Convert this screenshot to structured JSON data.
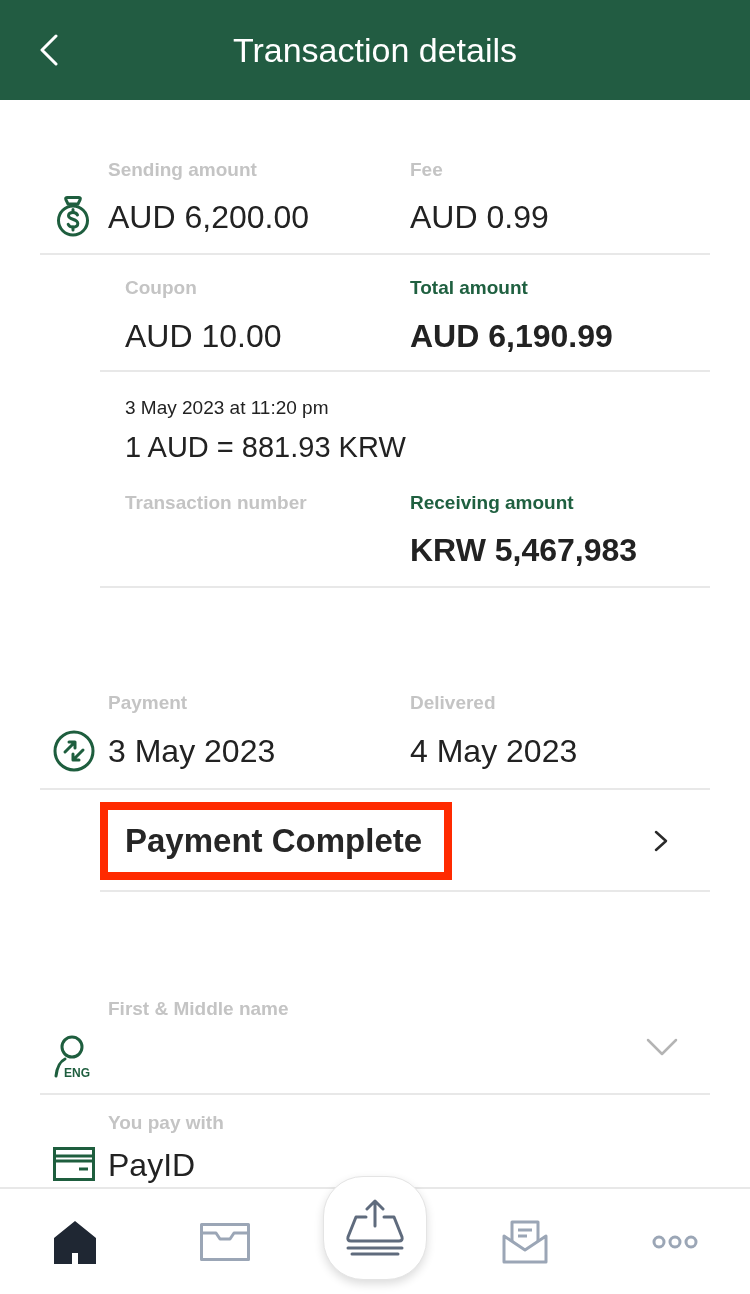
{
  "header": {
    "title": "Transaction details"
  },
  "sending": {
    "sending_amount": {
      "label": "Sending amount",
      "value": "AUD 6,200.00",
      "emphasis": false
    },
    "fee": {
      "label": "Fee",
      "value": "AUD 0.99",
      "emphasis": false
    }
  },
  "totals": {
    "coupon": {
      "label": "Coupon",
      "value": "AUD 10.00",
      "emphasis": false
    },
    "total_amount": {
      "label": "Total amount",
      "value": "AUD 6,190.99",
      "emphasis": true
    }
  },
  "exchange": {
    "timestamp": "3 May 2023 at 11:20 pm",
    "rate": "1 AUD = 881.93 KRW"
  },
  "receiving": {
    "transaction_number": {
      "label": "Transaction number",
      "emphasis": false
    },
    "receiving_amount": {
      "label": "Receiving amount",
      "value": "KRW 5,467,983",
      "emphasis": true
    }
  },
  "dates": {
    "payment": {
      "label": "Payment",
      "value": "3 May 2023",
      "emphasis": false
    },
    "delivered": {
      "label": "Delivered",
      "value": "4 May 2023",
      "emphasis": false
    }
  },
  "status": {
    "text": "Payment Complete",
    "highlighted": true
  },
  "recipient": {
    "label": "First & Middle name",
    "icon_badge": "ENG",
    "expanded": false
  },
  "payment_method": {
    "label": "You pay with",
    "value": "PayID"
  },
  "tab_bar": {
    "items": [
      {
        "kind": "home",
        "selected": true
      },
      {
        "kind": "inbox",
        "selected": false
      },
      {
        "kind": "send",
        "selected": false
      },
      {
        "kind": "mail",
        "selected": false
      },
      {
        "kind": "more",
        "selected": false
      }
    ]
  }
}
